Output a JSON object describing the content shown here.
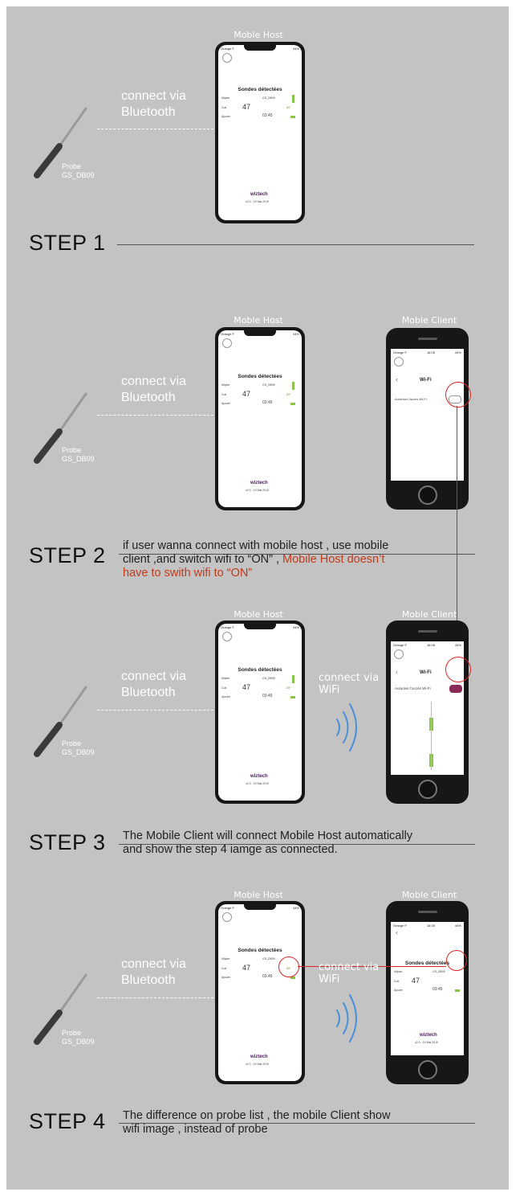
{
  "labels": {
    "mobile_host": "Moble Host",
    "mobile_client": "Moble Client",
    "connect_bt_line1": "connect via",
    "connect_bt_line2": "Bluetooth",
    "connect_wifi_line1": "connect via",
    "connect_wifi_line2": "WiFi",
    "probe_line1": "Probe",
    "probe_line2": "GS_DB09"
  },
  "phone_screen": {
    "carrier": "Orange F",
    "network": "4G",
    "time": "16:05",
    "battery": "44%",
    "title": "Sondes détectées",
    "probe_name": "GS_DB09",
    "temp": "47",
    "target": "89°",
    "row_label_1": "Mijoter",
    "row_label_2": "Cuit",
    "row_label_3": "Ajouter",
    "timer": "03:45",
    "brand": "wiztech",
    "version": "v2.0 - 19 Mai 2019",
    "wifi_title": "Wi-Fi",
    "wifi_toggle_label": "Autoriser l'accès Wi-Fi"
  },
  "steps": [
    {
      "title": "STEP 1",
      "desc": []
    },
    {
      "title": "STEP 2",
      "desc_line1": "if user wanna connect with mobile host , use mobile",
      "desc_line2_plain": "client ,and switch wifi to “ON” , ",
      "desc_line2_hl": "Mobile Host doesn’t",
      "desc_line3_hl": "have to swith wifi to “ON”"
    },
    {
      "title": "STEP 3",
      "desc_line1": "The Mobile Client will connect Mobile Host automatically",
      "desc_line2": "and show the step 4 iamge as connected."
    },
    {
      "title": "STEP 4",
      "desc_line1": "The difference on probe list , the mobile Client show",
      "desc_line2": "wifi image , instead of probe"
    }
  ],
  "colors": {
    "panel_bg": "#c3c3c3",
    "highlight_red": "#c23a1c",
    "connector_red": "#d62828",
    "wifi_waves": "#4a90d9",
    "phone_body": "#171717"
  }
}
